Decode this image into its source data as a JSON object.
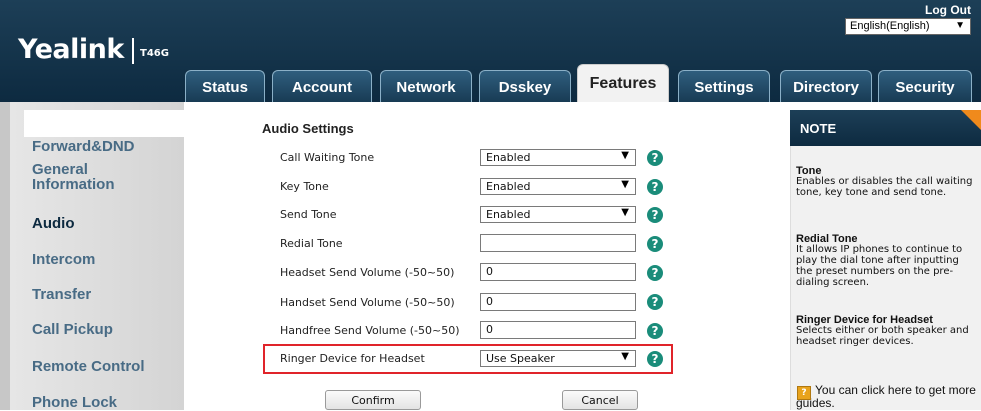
{
  "header": {
    "logo": "Yealink",
    "model": "T46G",
    "logout": "Log Out",
    "language": "English(English)"
  },
  "tabs": [
    {
      "label": "Status"
    },
    {
      "label": "Account"
    },
    {
      "label": "Network"
    },
    {
      "label": "Dsskey"
    },
    {
      "label": "Features",
      "active": true
    },
    {
      "label": "Settings"
    },
    {
      "label": "Directory"
    },
    {
      "label": "Security"
    }
  ],
  "sidebar": {
    "items": [
      {
        "label": "Forward&DND"
      },
      {
        "label": "General\nInformation"
      },
      {
        "label": "Audio",
        "active": true
      },
      {
        "label": "Intercom"
      },
      {
        "label": "Transfer"
      },
      {
        "label": "Call Pickup"
      },
      {
        "label": "Remote Control"
      },
      {
        "label": "Phone Lock"
      }
    ]
  },
  "main": {
    "section_title": "Audio Settings",
    "rows": [
      {
        "label": "Call Waiting Tone",
        "value": "Enabled",
        "type": "select"
      },
      {
        "label": "Key Tone",
        "value": "Enabled",
        "type": "select"
      },
      {
        "label": "Send Tone",
        "value": "Enabled",
        "type": "select"
      },
      {
        "label": "Redial Tone",
        "value": "",
        "type": "input"
      },
      {
        "label": "Headset Send Volume (-50~50)",
        "value": "0",
        "type": "input"
      },
      {
        "label": "Handset Send Volume (-50~50)",
        "value": "0",
        "type": "input"
      },
      {
        "label": "Handfree Send Volume (-50~50)",
        "value": "0",
        "type": "input"
      },
      {
        "label": "Ringer Device for Headset",
        "value": "Use Speaker",
        "type": "select"
      }
    ],
    "help_glyph": "?",
    "confirm_label": "Confirm",
    "cancel_label": "Cancel"
  },
  "note": {
    "title": "NOTE",
    "sections": [
      {
        "heading": "Tone",
        "text": "Enables or disables the call waiting tone, key tone and send tone."
      },
      {
        "heading": "Redial Tone",
        "text": "It allows IP phones to continue to play the dial tone after inputting the preset numbers on the pre-dialing screen."
      },
      {
        "heading": "Ringer Device for Headset",
        "text": "Selects either or both speaker and headset ringer devices."
      }
    ],
    "guide_text": "You can click here to get more guides."
  },
  "colors": {
    "header_bg": "#0d2a40",
    "help_icon": "#1a8c7a",
    "highlight_border": "#e0242a",
    "note_corner": "#f08a1c"
  }
}
